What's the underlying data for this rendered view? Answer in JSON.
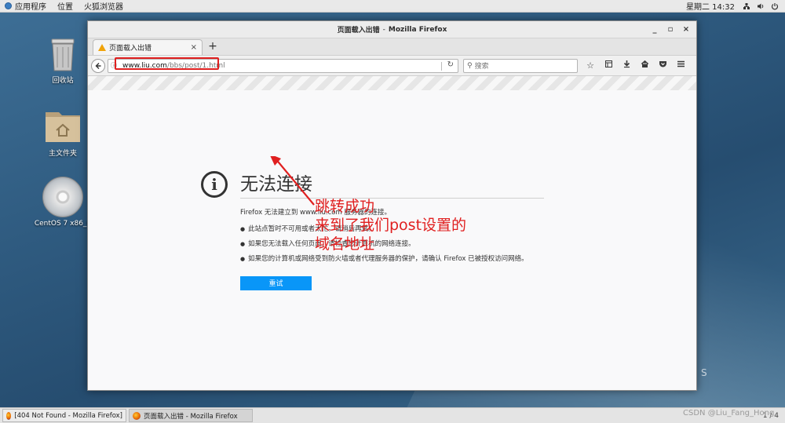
{
  "top_panel": {
    "apps": "应用程序",
    "places": "位置",
    "browser": "火狐浏览器",
    "clock": "星期二 14:32"
  },
  "desktop": {
    "trash_label": "回收站",
    "home_label": "主文件夹",
    "cd_label": "CentOS 7 x86_6"
  },
  "window": {
    "title": "页面载入出错",
    "title_sep": "-",
    "app_name": "Mozilla Firefox",
    "minimize": "_",
    "maximize": "▫",
    "close": "×"
  },
  "tab": {
    "title": "页面载入出错",
    "close": "×",
    "new_tab": "+"
  },
  "navbar": {
    "url_host": "www.liu.com",
    "url_path": "/bbs/post/1.html",
    "search_placeholder": "搜索"
  },
  "error_page": {
    "title": "无法连接",
    "description": "Firefox 无法建立到 www.liu.com 服务器的连接。",
    "bullets": [
      "此站点暂时不可用或者太忙。请稍后再试。",
      "如果您无法载入任何页面，请检查您计算机的网络连接。",
      "如果您的计算机或网络受到防火墙或者代理服务器的保护，请确认 Firefox 已被授权访问网络。"
    ],
    "retry_label": "重试"
  },
  "annotation": {
    "line1": "跳转成功",
    "line2": "来到了我们post设置的",
    "line3": "域名地址",
    "color": "#e02020"
  },
  "taskbar": {
    "item1": "[404 Not Found - Mozilla Firefox]",
    "item2": "页面载入出错 - Mozilla Firefox",
    "pager": "1 / 4"
  },
  "watermark": "CSDN @Liu_Fang_Hong",
  "desktop_stray_text": "S",
  "colors": {
    "accent_button": "#0996f8",
    "annotation_red": "#e02020",
    "desktop_blue": "#2f5b80"
  }
}
